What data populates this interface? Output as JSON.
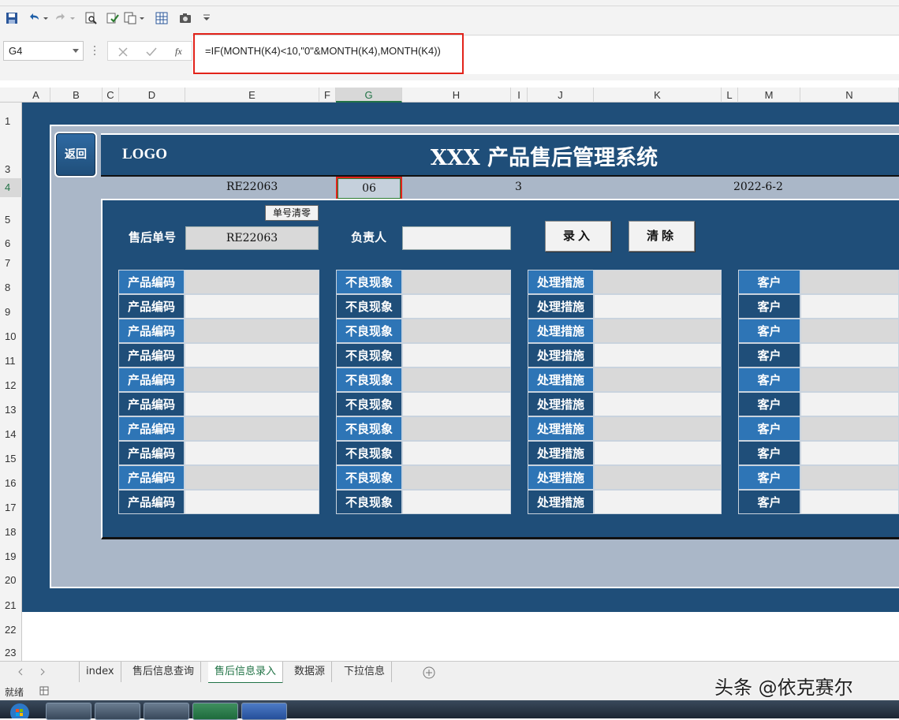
{
  "formula_bar": {
    "name_box": "G4",
    "formula": "=IF(MONTH(K4)<10,\"0\"&MONTH(K4),MONTH(K4))"
  },
  "columns": [
    {
      "letter": "A",
      "selected": false
    },
    {
      "letter": "B",
      "selected": false
    },
    {
      "letter": "C",
      "selected": false
    },
    {
      "letter": "D",
      "selected": false
    },
    {
      "letter": "E",
      "selected": false
    },
    {
      "letter": "F",
      "selected": false
    },
    {
      "letter": "G",
      "selected": true
    },
    {
      "letter": "H",
      "selected": false
    },
    {
      "letter": "I",
      "selected": false
    },
    {
      "letter": "J",
      "selected": false
    },
    {
      "letter": "K",
      "selected": false
    },
    {
      "letter": "L",
      "selected": false
    },
    {
      "letter": "M",
      "selected": false
    },
    {
      "letter": "N",
      "selected": false
    }
  ],
  "rows": [
    "1",
    "3",
    "4",
    "5",
    "6",
    "7",
    "8",
    "9",
    "10",
    "11",
    "12",
    "13",
    "14",
    "15",
    "16",
    "17",
    "18",
    "19",
    "20",
    "21",
    "22",
    "23"
  ],
  "selected_row": "4",
  "sheet": {
    "back_button": "返回",
    "logo": "LOGO",
    "title": "XXX 产品售后管理系统",
    "row4": {
      "order_no": "RE22063",
      "month": "06",
      "seq": "3",
      "date": "2022-6-2"
    },
    "clear_no_button": "单号清零",
    "order_label": "售后单号",
    "order_value": "RE22063",
    "owner_label": "负责人",
    "owner_value": "",
    "enter_button": "录入",
    "clear_button": "清除",
    "table": {
      "col1_label": "产品编码",
      "col2_label": "不良现象",
      "col3_label": "处理措施",
      "col4_label": "客户",
      "row_count": 10
    }
  },
  "tabs": [
    {
      "label": "index",
      "active": false
    },
    {
      "label": "售后信息查询",
      "active": false
    },
    {
      "label": "售后信息录入",
      "active": true
    },
    {
      "label": "数据源",
      "active": false
    },
    {
      "label": "下拉信息",
      "active": false
    }
  ],
  "status_text": "就绪",
  "watermark": "头条 @依克赛尔",
  "colors": {
    "navy": "#1f4e79",
    "blue": "#2e75b6",
    "highlight": "#e2231a",
    "excel_green": "#217346"
  }
}
